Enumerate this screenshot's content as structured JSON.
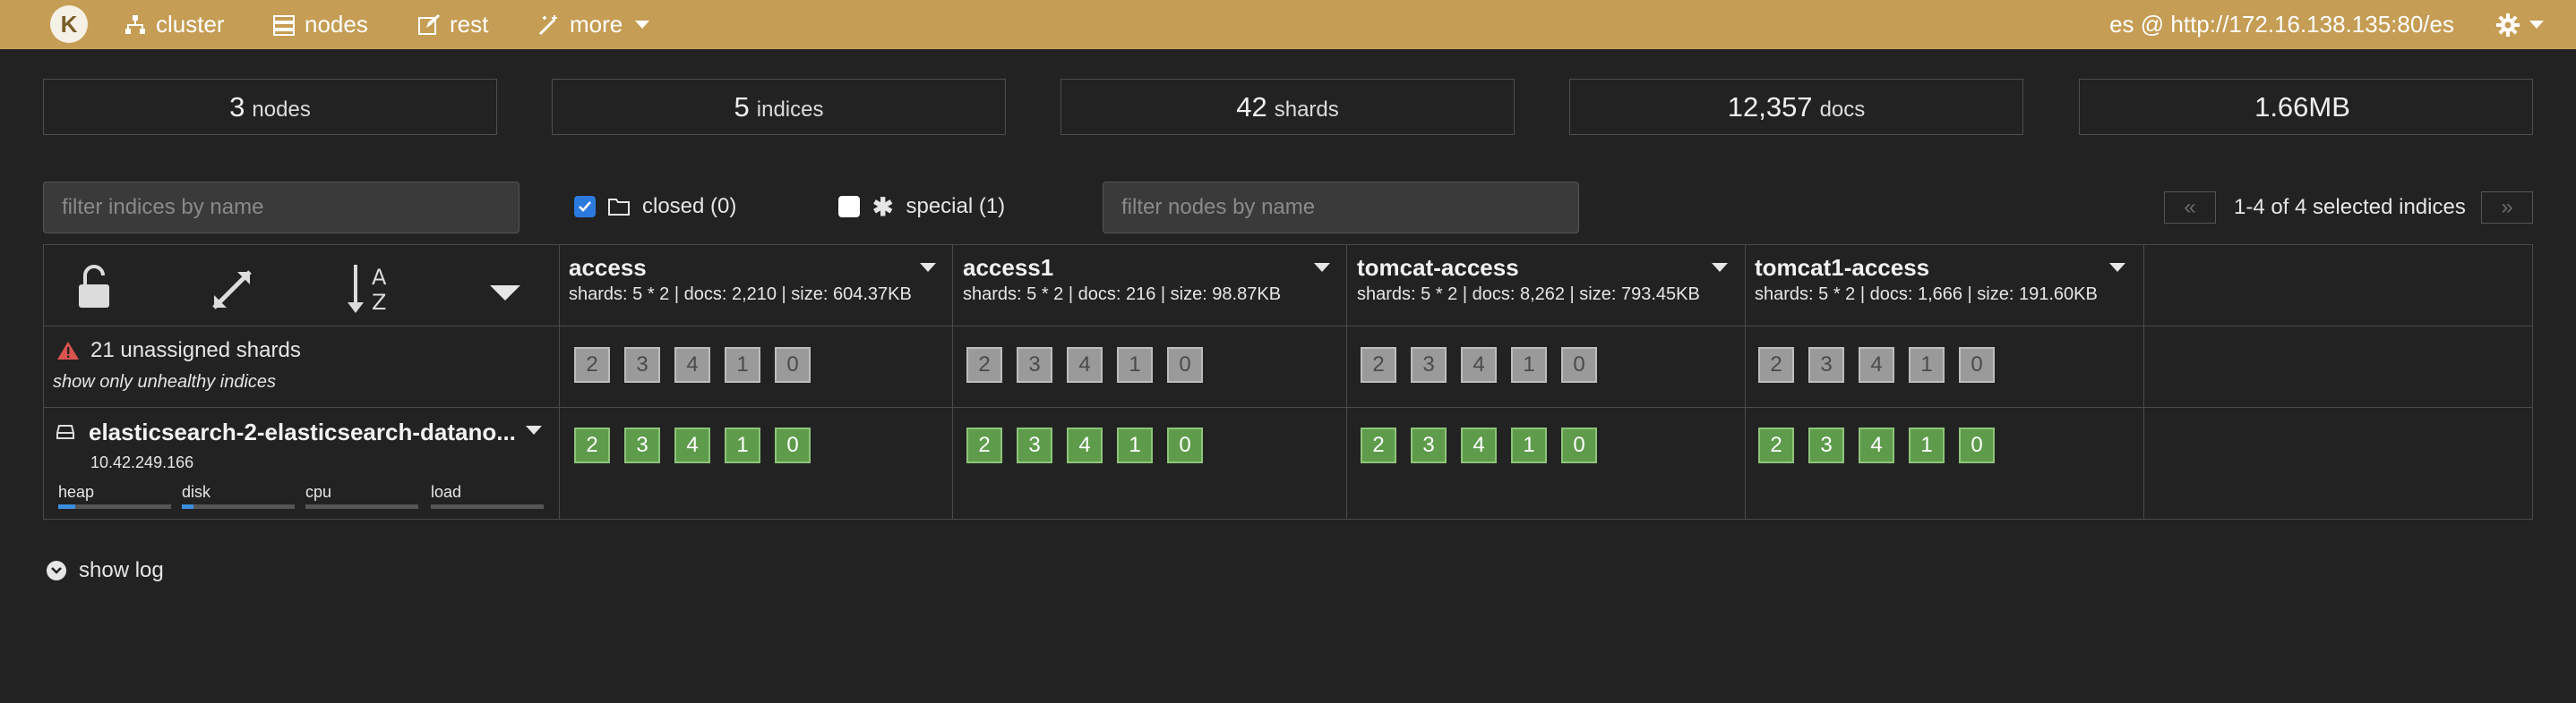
{
  "nav": {
    "logo_letter": "K",
    "items": [
      {
        "label": "cluster",
        "icon": "sitemap-icon"
      },
      {
        "label": "nodes",
        "icon": "server-icon"
      },
      {
        "label": "rest",
        "icon": "edit-icon"
      },
      {
        "label": "more",
        "icon": "magic-icon"
      }
    ],
    "connection": "es @ http://172.16.138.135:80/es"
  },
  "stats": [
    {
      "value": "3",
      "label": "nodes"
    },
    {
      "value": "5",
      "label": "indices"
    },
    {
      "value": "42",
      "label": "shards"
    },
    {
      "value": "12,357",
      "label": "docs"
    },
    {
      "value": "1.66MB",
      "label": ""
    }
  ],
  "filters": {
    "indices_placeholder": "filter indices by name",
    "nodes_placeholder": "filter nodes by name",
    "closed_label": "closed (0)",
    "special_label": "special (1)",
    "pager_prev": "«",
    "pager_next": "»",
    "pager_text": "1-4 of 4 selected indices"
  },
  "indices": [
    {
      "name": "access",
      "meta": "shards: 5 * 2 | docs: 2,210 | size: 604.37KB"
    },
    {
      "name": "access1",
      "meta": "shards: 5 * 2 | docs: 216 | size: 98.87KB"
    },
    {
      "name": "tomcat-access",
      "meta": "shards: 5 * 2 | docs: 8,262 | size: 793.45KB"
    },
    {
      "name": "tomcat1-access",
      "meta": "shards: 5 * 2 | docs: 1,666 | size: 191.60KB"
    }
  ],
  "shard_numbers": [
    "2",
    "3",
    "4",
    "1",
    "0"
  ],
  "unassigned": {
    "text": "21 unassigned shards",
    "link": "show only unhealthy indices"
  },
  "node": {
    "name": "elasticsearch-2-elasticsearch-datano...",
    "ip": "10.42.249.166",
    "metrics": [
      {
        "label": "heap",
        "level": 0.15
      },
      {
        "label": "disk",
        "level": 0.1
      },
      {
        "label": "cpu",
        "level": 0
      },
      {
        "label": "load",
        "level": 0
      }
    ]
  },
  "sort_icon_text": {
    "top": "A",
    "bottom": "Z"
  },
  "show_log": "show log",
  "colors": {
    "navbar": "#c59d54",
    "background": "#222222",
    "assigned": "#5e9b4b",
    "unassigned": "#9a9a9a",
    "bar_fill": "#3a8ee0"
  }
}
